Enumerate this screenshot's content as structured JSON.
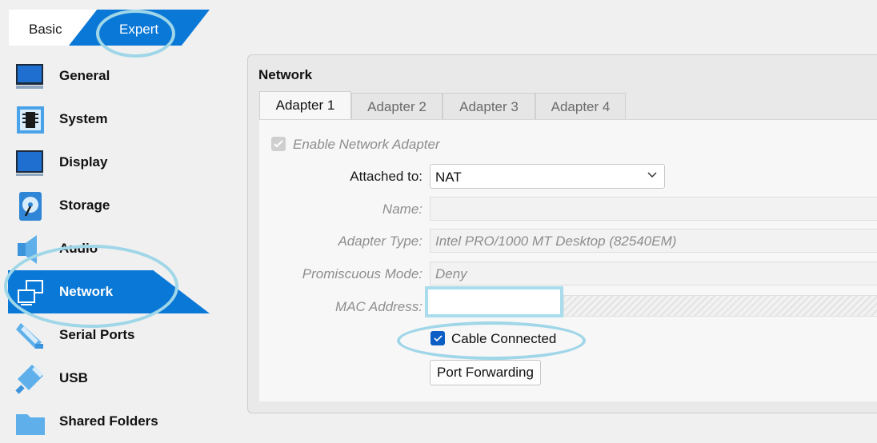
{
  "mode_tabs": {
    "basic": "Basic",
    "expert": "Expert",
    "active": "Expert"
  },
  "sidebar": {
    "items": [
      {
        "label": "General",
        "icon": "monitor-icon"
      },
      {
        "label": "System",
        "icon": "chip-icon"
      },
      {
        "label": "Display",
        "icon": "display-icon"
      },
      {
        "label": "Storage",
        "icon": "disk-icon"
      },
      {
        "label": "Audio",
        "icon": "speaker-icon"
      },
      {
        "label": "Network",
        "icon": "network-icon",
        "active": true
      },
      {
        "label": "Serial Ports",
        "icon": "serial-port-icon"
      },
      {
        "label": "USB",
        "icon": "usb-icon"
      },
      {
        "label": "Shared Folders",
        "icon": "folder-icon"
      }
    ]
  },
  "main": {
    "title": "Network",
    "tabs": [
      {
        "label": "Adapter 1",
        "active": true
      },
      {
        "label": "Adapter 2"
      },
      {
        "label": "Adapter 3"
      },
      {
        "label": "Adapter 4"
      }
    ],
    "enable_adapter": {
      "label": "Enable Network Adapter",
      "checked": true,
      "disabled": true
    },
    "attached_to": {
      "label": "Attached to:",
      "value": "NAT"
    },
    "name": {
      "label": "Name:",
      "value": ""
    },
    "adapter_type": {
      "label": "Adapter Type:",
      "value": "Intel PRO/1000 MT Desktop (82540EM)"
    },
    "promiscuous_mode": {
      "label": "Promiscuous Mode:",
      "value": "Deny"
    },
    "mac_address": {
      "label": "MAC Address:",
      "value": ""
    },
    "cable_connected": {
      "label": "Cable Connected",
      "checked": true
    },
    "port_forwarding": {
      "label": "Port Forwarding"
    }
  },
  "colors": {
    "accent": "#0a78d7",
    "highlight_ring": "#9fd6e8",
    "checkbox": "#0a5ec4"
  }
}
